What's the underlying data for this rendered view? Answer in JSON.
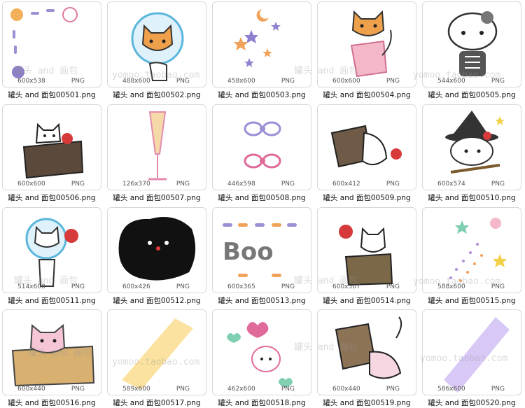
{
  "colors": {
    "border": "#d9d9d9",
    "text": "#111111",
    "meta": "#555555"
  },
  "watermark": {
    "text_a": "罐头 and 面包",
    "text_b": "yomoo.taobao.com"
  },
  "items": [
    {
      "file": "罐头 and 面包00501.png",
      "size": "600x538",
      "format": "PNG",
      "icon": "corner-border-pets"
    },
    {
      "file": "罐头 and 面包00502.png",
      "size": "488x600",
      "format": "PNG",
      "icon": "cat-astronaut"
    },
    {
      "file": "罐头 and 面包00503.png",
      "size": "458x600",
      "format": "PNG",
      "icon": "moon-stars"
    },
    {
      "file": "罐头 and 面包00504.png",
      "size": "600x600",
      "format": "PNG",
      "icon": "cat-bag"
    },
    {
      "file": "罐头 and 面包00505.png",
      "size": "544x600",
      "format": "PNG",
      "icon": "kitty-skeleton"
    },
    {
      "file": "罐头 and 面包00506.png",
      "size": "600x600",
      "format": "PNG",
      "icon": "cat-in-box"
    },
    {
      "file": "罐头 and 面包00507.png",
      "size": "126x370",
      "format": "PNG",
      "icon": "champagne-glass"
    },
    {
      "file": "罐头 and 面包00508.png",
      "size": "446x598",
      "format": "PNG",
      "icon": "bows"
    },
    {
      "file": "罐头 and 面包00509.png",
      "size": "600x412",
      "format": "PNG",
      "icon": "cat-paper-bag"
    },
    {
      "file": "罐头 and 面包00510.png",
      "size": "600x574",
      "format": "PNG",
      "icon": "kitty-witch"
    },
    {
      "file": "罐头 and 面包00511.png",
      "size": "514x600",
      "format": "PNG",
      "icon": "cat-astronaut-bundle"
    },
    {
      "file": "罐头 and 面包00512.png",
      "size": "600x426",
      "format": "PNG",
      "icon": "black-scribble-blob"
    },
    {
      "file": "罐头 and 面包00513.png",
      "size": "600x365",
      "format": "PNG",
      "icon": "boo-bones"
    },
    {
      "file": "罐头 and 面包00514.png",
      "size": "600x507",
      "format": "PNG",
      "icon": "cat-bundle-box"
    },
    {
      "file": "罐头 and 面包00515.png",
      "size": "588x600",
      "format": "PNG",
      "icon": "stars-dots"
    },
    {
      "file": "罐头 and 面包00516.png",
      "size": "600x440",
      "format": "PNG",
      "icon": "pink-cat-box"
    },
    {
      "file": "罐头 and 面包00517.png",
      "size": "589x600",
      "format": "PNG",
      "icon": "yellow-ribbon"
    },
    {
      "file": "罐头 and 面包00518.png",
      "size": "462x600",
      "format": "PNG",
      "icon": "bunny-hearts"
    },
    {
      "file": "罐头 and 面包00519.png",
      "size": "600x440",
      "format": "PNG",
      "icon": "pink-cat-bag"
    },
    {
      "file": "罐头 and 面包00520.png",
      "size": "586x600",
      "format": "PNG",
      "icon": "purple-ribbon"
    }
  ]
}
